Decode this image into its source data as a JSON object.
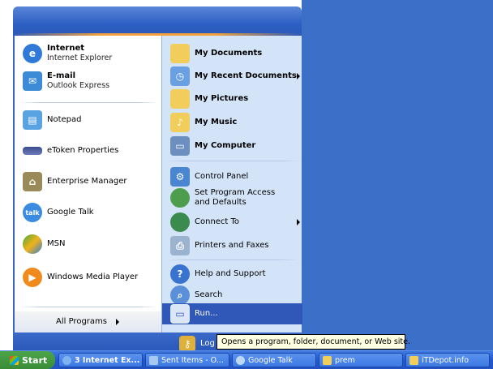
{
  "left_items": [
    {
      "title": "Internet",
      "subtitle": "Internet Explorer",
      "icon": "internet-explorer-icon"
    },
    {
      "title": "E-mail",
      "subtitle": "Outlook Express",
      "icon": "outlook-express-icon"
    },
    {
      "title": "Notepad",
      "icon": "notepad-icon"
    },
    {
      "title": "eToken Properties",
      "icon": "etoken-icon"
    },
    {
      "title": "Enterprise Manager",
      "icon": "enterprise-manager-icon"
    },
    {
      "title": "Google Talk",
      "icon": "google-talk-icon"
    },
    {
      "title": "MSN",
      "icon": "msn-icon"
    },
    {
      "title": "Windows Media Player",
      "icon": "media-player-icon"
    }
  ],
  "all_programs": "All Programs",
  "right_items": [
    {
      "label": "My Documents",
      "icon": "folder-icon"
    },
    {
      "label": "My Recent Documents",
      "icon": "recent-docs-icon"
    },
    {
      "label": "My Pictures",
      "icon": "pictures-folder-icon"
    },
    {
      "label": "My Music",
      "icon": "music-folder-icon"
    },
    {
      "label": "My Computer",
      "icon": "computer-icon"
    },
    {
      "label": "Control Panel",
      "icon": "control-panel-icon"
    },
    {
      "label": "Set Program Access and Defaults",
      "icon": "program-access-icon"
    },
    {
      "label": "Connect To",
      "icon": "connect-icon"
    },
    {
      "label": "Printers and Faxes",
      "icon": "printer-icon"
    },
    {
      "label": "Help and Support",
      "icon": "help-icon"
    },
    {
      "label": "Search",
      "icon": "search-icon"
    },
    {
      "label": "Run...",
      "icon": "run-icon"
    }
  ],
  "logoff": "Log",
  "tooltip": "Opens a program, folder, document, or Web site.",
  "taskbar": {
    "start": "Start",
    "tasks": [
      "3 Internet Ex...",
      "Sent Items - O...",
      "Google Talk",
      "prem",
      "iTDepot.info"
    ]
  },
  "colors": {
    "desktop": "#3b6fc8",
    "menu_header": "#2d5fc4",
    "right_pane": "#d3e3f8",
    "taskbar": "#2557d0",
    "start": "#3a8c37"
  }
}
